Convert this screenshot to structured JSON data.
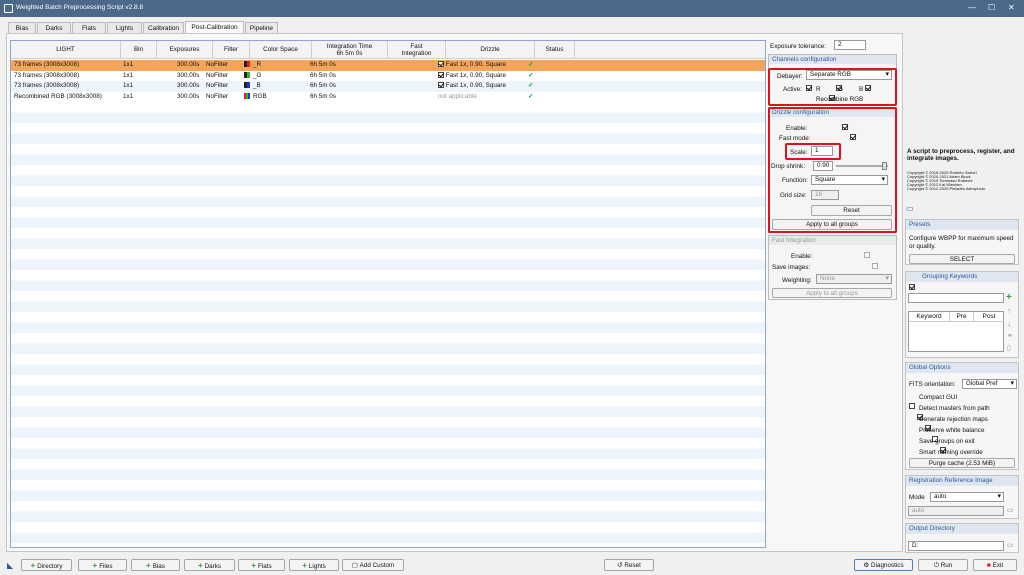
{
  "window": {
    "title": "Weighted Batch Preprocessing Script v2.8.8"
  },
  "tabs": [
    {
      "label": "Bias"
    },
    {
      "label": "Darks"
    },
    {
      "label": "Flats"
    },
    {
      "label": "Lights"
    },
    {
      "label": "Calibration"
    },
    {
      "label": "Post-Calibration"
    },
    {
      "label": "Pipeline"
    }
  ],
  "table": {
    "headers": {
      "light": "LIGHT",
      "bin": "Bin",
      "exposures": "Exposures",
      "filter": "Filter",
      "colorspace": "Color Space",
      "integration_time": "Integration Time",
      "integration_sub": "6h  5m  0s",
      "fast": "Fast",
      "fast2": "Integration",
      "drizzle": "Drizzle",
      "status": "Status"
    },
    "rows": [
      {
        "light": "73 frames (3008x3008)",
        "bin": "1x1",
        "exposures": "300.00s",
        "filter": "NoFilter",
        "colorspace": "_R",
        "time": "6h  5m  0s",
        "drizzle": "Fast 1x, 0.90, Square",
        "status": "✓"
      },
      {
        "light": "73 frames (3008x3008)",
        "bin": "1x1",
        "exposures": "300.00s",
        "filter": "NoFilter",
        "colorspace": "_G",
        "time": "6h  5m  0s",
        "drizzle": "Fast 1x, 0.90, Square",
        "status": "✓"
      },
      {
        "light": "73 frames (3008x3008)",
        "bin": "1x1",
        "exposures": "300.00s",
        "filter": "NoFilter",
        "colorspace": "_B",
        "time": "6h  5m  0s",
        "drizzle": "Fast 1x, 0.90, Square",
        "status": "✓"
      },
      {
        "light": "Recombined RGB (3008x3008)",
        "bin": "1x1",
        "exposures": "300.00s",
        "filter": "NoFilter",
        "colorspace": "RGB",
        "time": "6h  5m  0s",
        "drizzle": "not applicable",
        "status": "✓"
      }
    ]
  },
  "exposure_tolerance": {
    "label": "Exposure tolerance:",
    "value": "2"
  },
  "channels": {
    "title": "Channels configuration",
    "debayer_label": "Debayer:",
    "debayer_value": "Separate RGB",
    "active_label": "Active:",
    "r": "R",
    "g": "G",
    "b": "B",
    "recombine": "Recombine RGB"
  },
  "drizzle": {
    "title": "Drizzle configuration",
    "enable": "Enable:",
    "fast": "Fast mode:",
    "scale_label": "Scale:",
    "scale_value": "1",
    "drop_label": "Drop shrink:",
    "drop_value": "0.90",
    "function_label": "Function:",
    "function_value": "Square",
    "grid_label": "Grid size:",
    "grid_value": "16",
    "reset": "Reset",
    "apply": "Apply to all groups"
  },
  "fast_integration": {
    "title": "Fast Integration",
    "enable": "Enable:",
    "save": "Save images:",
    "weighting_label": "Weighting:",
    "weighting_value": "None",
    "apply": "Apply to all groups"
  },
  "about": {
    "text": "A script to preprocess, register, and integrate images.",
    "c1": "Copyright © 2019-2025 Roberto Sartori",
    "c2": "Copyright © 2020-2021 Adam Block",
    "c3": "Copyright © 2019 Tommaso Rubechi",
    "c4": "Copyright © 2012 Kai Wiechen",
    "c5": "Copyright © 2012-2025 Pleiades Astrophoto"
  },
  "presets": {
    "title": "Presets",
    "text": "Configure WBPP for maximum speed or quality.",
    "select": "SELECT"
  },
  "grouping": {
    "title": "Grouping Keywords",
    "cols": [
      "Keyword",
      "Pre",
      "Post"
    ]
  },
  "global": {
    "title": "Global Options",
    "fits_label": "FITS orientation:",
    "fits_value": "Global Pref",
    "opts": [
      {
        "label": "Compact GUI",
        "on": false
      },
      {
        "label": "Detect masters from path",
        "on": true
      },
      {
        "label": "Generate rejection maps",
        "on": true
      },
      {
        "label": "Preserve white balance",
        "on": false
      },
      {
        "label": "Save groups on exit",
        "on": true
      },
      {
        "label": "Smart naming override",
        "on": false
      }
    ],
    "purge": "Purge cache (2.53 MiB)"
  },
  "registration": {
    "title": "Registration Reference Image",
    "mode_label": "Mode",
    "mode_value": "auto",
    "field": "auto"
  },
  "output": {
    "title": "Output Directory",
    "value": "D:"
  },
  "bottom": {
    "directory": "Directory",
    "files": "Files",
    "bias": "Bias",
    "darks": "Darks",
    "flats": "Flats",
    "lights": "Lights",
    "add_custom": "Add Custom",
    "reset": "Reset",
    "diagnostics": "Diagnostics",
    "run": "Run",
    "exit": "Exit"
  },
  "colors": {
    "selected_row": "#f4a55a",
    "accent": "#2b5aa0",
    "highlight": "#e0101c"
  }
}
